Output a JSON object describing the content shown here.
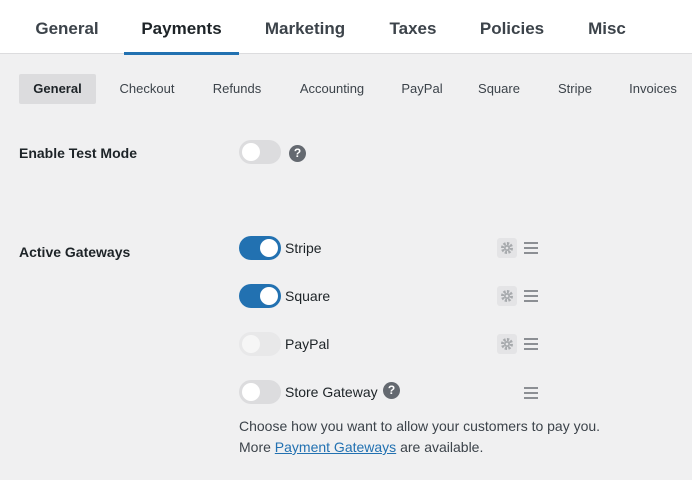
{
  "top_tabs": [
    {
      "label": "General"
    },
    {
      "label": "Payments"
    },
    {
      "label": "Marketing"
    },
    {
      "label": "Taxes"
    },
    {
      "label": "Policies"
    },
    {
      "label": "Misc"
    }
  ],
  "active_top_tab": "Payments",
  "sub_tabs": [
    {
      "label": "General"
    },
    {
      "label": "Checkout"
    },
    {
      "label": "Refunds"
    },
    {
      "label": "Accounting"
    },
    {
      "label": "PayPal"
    },
    {
      "label": "Square"
    },
    {
      "label": "Stripe"
    },
    {
      "label": "Invoices"
    }
  ],
  "active_sub_tab": "General",
  "test_mode": {
    "label": "Enable Test Mode",
    "enabled": false,
    "help_glyph": "?"
  },
  "gateways": {
    "label": "Active Gateways",
    "items": [
      {
        "name": "Stripe",
        "enabled": true,
        "has_settings": true
      },
      {
        "name": "Square",
        "enabled": true,
        "has_settings": true
      },
      {
        "name": "PayPal",
        "enabled": false,
        "disabled": true,
        "has_settings": true
      },
      {
        "name": "Store Gateway",
        "enabled": false,
        "has_settings": false,
        "help_glyph": "?"
      }
    ],
    "description_line1": "Choose how you want to allow your customers to pay you.",
    "description_line2_pre": "More ",
    "description_link": "Payment Gateways",
    "description_line2_post": " are available."
  },
  "colors": {
    "accent": "#2271b1",
    "background": "#f0f0f1",
    "toggle_off": "#dcdcde"
  }
}
